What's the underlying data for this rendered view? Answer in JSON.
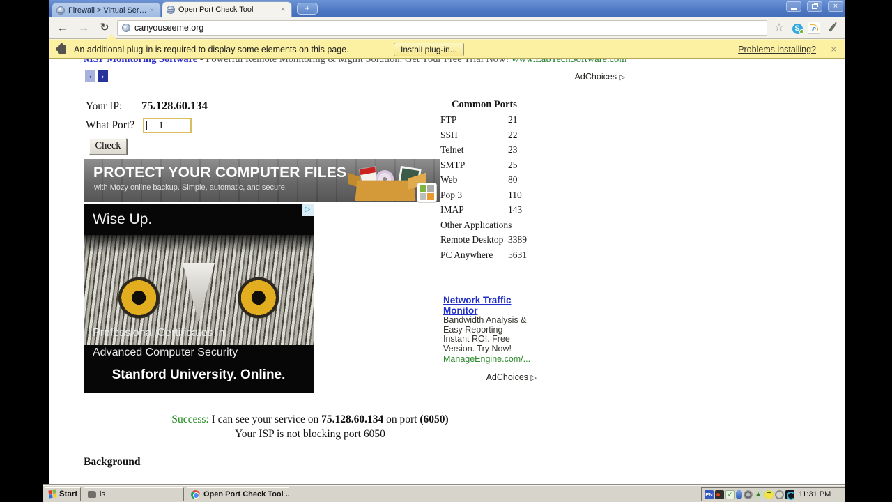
{
  "browser": {
    "tabs": [
      {
        "title": "Firewall > Virtual Servers"
      },
      {
        "title": "Open Port Check Tool"
      }
    ],
    "url": "canyouseeme.org",
    "icons": {
      "back": "←",
      "forward": "→",
      "reload": "↻",
      "star": "☆",
      "skype_s": "S",
      "ie_e": "e",
      "new_tab": "+",
      "tab_close": "×",
      "window_close": "×"
    }
  },
  "infobar": {
    "message": "An additional plug-in is required to display some elements on this page.",
    "install_button": "Install plug-in...",
    "problems_link": "Problems installing?",
    "close": "×"
  },
  "page": {
    "top_ad": {
      "link": "MSP Monitoring Software",
      "text": " - Powerful Remote Monitoring & Mgmt Solution. Get Your Free Trial Now! ",
      "url": "www.LabTechSoftware.com",
      "prev": "‹",
      "next": "›",
      "adchoices": "AdChoices",
      "adchoices_arrow": "▷"
    },
    "form": {
      "your_ip_label": "Your IP:",
      "your_ip": "75.128.60.134",
      "port_label": "What Port?",
      "port_value": "",
      "cursor_glyph": "I",
      "check_label": "Check"
    },
    "mozy_ad": {
      "title": "PROTECT YOUR COMPUTER FILES",
      "subtitle": "with Mozy online backup. Simple, automatic, and secure."
    },
    "owl_ad": {
      "headline": "Wise Up.",
      "line1": "Professional Certificates in",
      "line2": "Advanced Computer Security",
      "footer": "Stanford University. Online.",
      "adchoices_arrow": "▷"
    },
    "common_ports": {
      "title": "Common Ports",
      "rows": [
        {
          "name": "FTP",
          "port": "21"
        },
        {
          "name": "SSH",
          "port": "22"
        },
        {
          "name": "Telnet",
          "port": "23"
        },
        {
          "name": "SMTP",
          "port": "25"
        },
        {
          "name": "Web",
          "port": "80"
        },
        {
          "name": "Pop 3",
          "port": "110"
        },
        {
          "name": "IMAP",
          "port": "143"
        },
        {
          "name": "Other Applications",
          "port": ""
        },
        {
          "name": "Remote Desktop",
          "port": "3389"
        },
        {
          "name": "PC Anywhere",
          "port": "5631"
        }
      ]
    },
    "network_ad": {
      "title_line1": "Network Traffic",
      "title_line2": "Monitor",
      "lines": [
        "Bandwidth Analysis &",
        "Easy Reporting",
        "Instant ROI. Free",
        "Version. Try Now!"
      ],
      "link": "ManageEngine.com/...",
      "adchoices": "AdChoices",
      "adchoices_arrow": "▷"
    },
    "success": {
      "label": "Success:",
      "text_before_ip": " I can see your service on ",
      "ip": "75.128.60.134",
      "text_before_port": " on port ",
      "port": "(6050)",
      "line2": "Your ISP is not blocking port 6050"
    },
    "background_heading": "Background"
  },
  "taskbar": {
    "start_label": "Start",
    "task1_label": "ls",
    "task2_label": "Open Port Check Tool ...",
    "lang_indicator": "EN",
    "tray_check": "✓",
    "time": "11:31 PM"
  },
  "colors": {
    "accent_blue_link": "#2a2ac8",
    "green_link": "#1d7a2a",
    "success_green": "#1e8a1e",
    "infobar_yellow": "#fcf0a2",
    "titlebar_blue": "#4d77c3",
    "taskbar_gray": "#d7d5cb"
  }
}
